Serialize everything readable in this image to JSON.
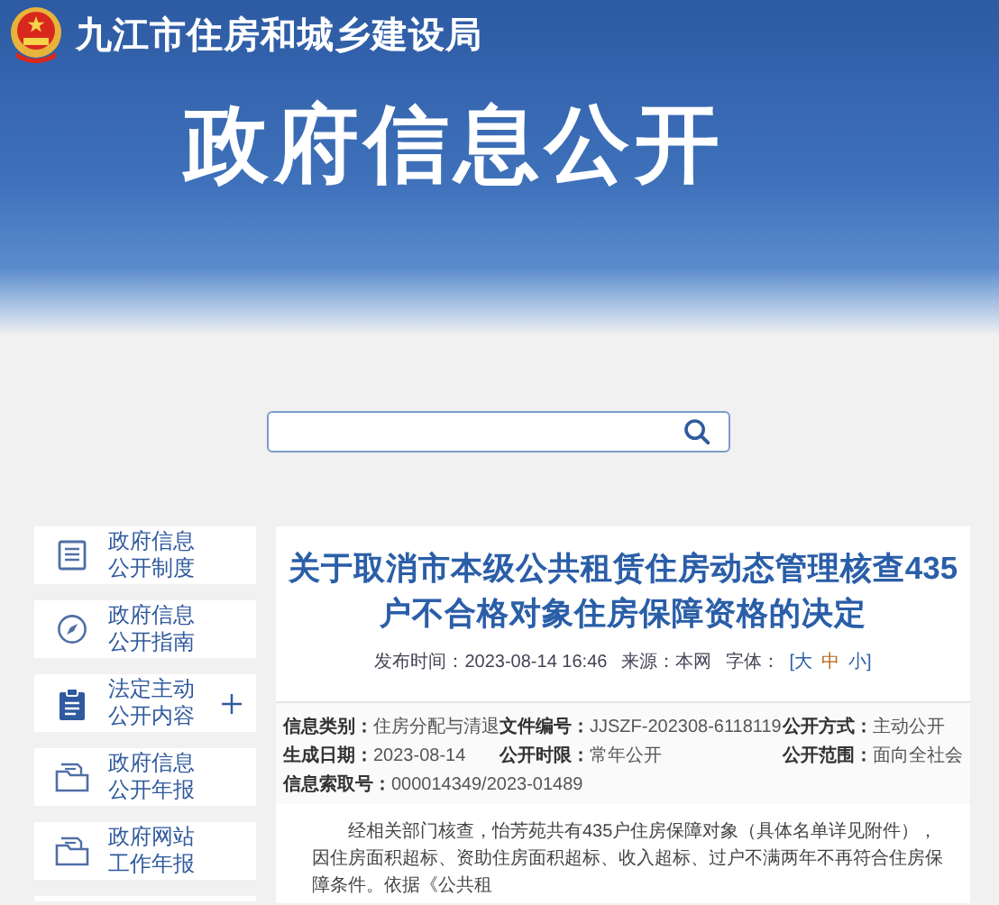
{
  "header": {
    "site_title": "九江市住房和城乡建设局",
    "banner_title": "政府信息公开"
  },
  "sidebar": {
    "items": [
      {
        "line1": "政府信息",
        "line2": "公开制度",
        "expandable": false
      },
      {
        "line1": "政府信息",
        "line2": "公开指南",
        "expandable": false
      },
      {
        "line1": "法定主动",
        "line2": "公开内容",
        "expandable": true
      },
      {
        "line1": "政府信息",
        "line2": "公开年报",
        "expandable": false
      },
      {
        "line1": "政府网站",
        "line2": "工作年报",
        "expandable": false
      }
    ]
  },
  "article": {
    "title": "关于取消市本级公共租赁住房动态管理核查435户不合格对象住房保障资格的决定",
    "meta": [
      {
        "label": "发布时间：",
        "value": "2023-08-14 16:46"
      },
      {
        "label": "来源：",
        "value": "本网"
      }
    ],
    "font_size_label": "字体：",
    "font_sizes": [
      {
        "text": "[大",
        "selected": false
      },
      {
        "text": "中",
        "selected": true
      },
      {
        "text": "小]",
        "selected": false
      }
    ],
    "info": [
      {
        "label": "信息类别：",
        "value": "住房分配与清退"
      },
      {
        "label": "文件编号：",
        "value": "JJSZF-202308-6118119"
      },
      {
        "label": "公开方式：",
        "value": "主动公开"
      },
      {
        "label": "生成日期：",
        "value": "2023-08-14"
      },
      {
        "label": "公开时限：",
        "value": "常年公开"
      },
      {
        "label": "公开范围：",
        "value": "面向全社会"
      },
      {
        "label": "信息索取号：",
        "value": "000014349/2023-01489"
      }
    ],
    "body": "经相关部门核查，怡芳苑共有435户住房保障对象（具体名单详见附件），因住房面积超标、资助住房面积超标、收入超标、过户不满两年不再符合住房保障条件。依据《公共租"
  }
}
